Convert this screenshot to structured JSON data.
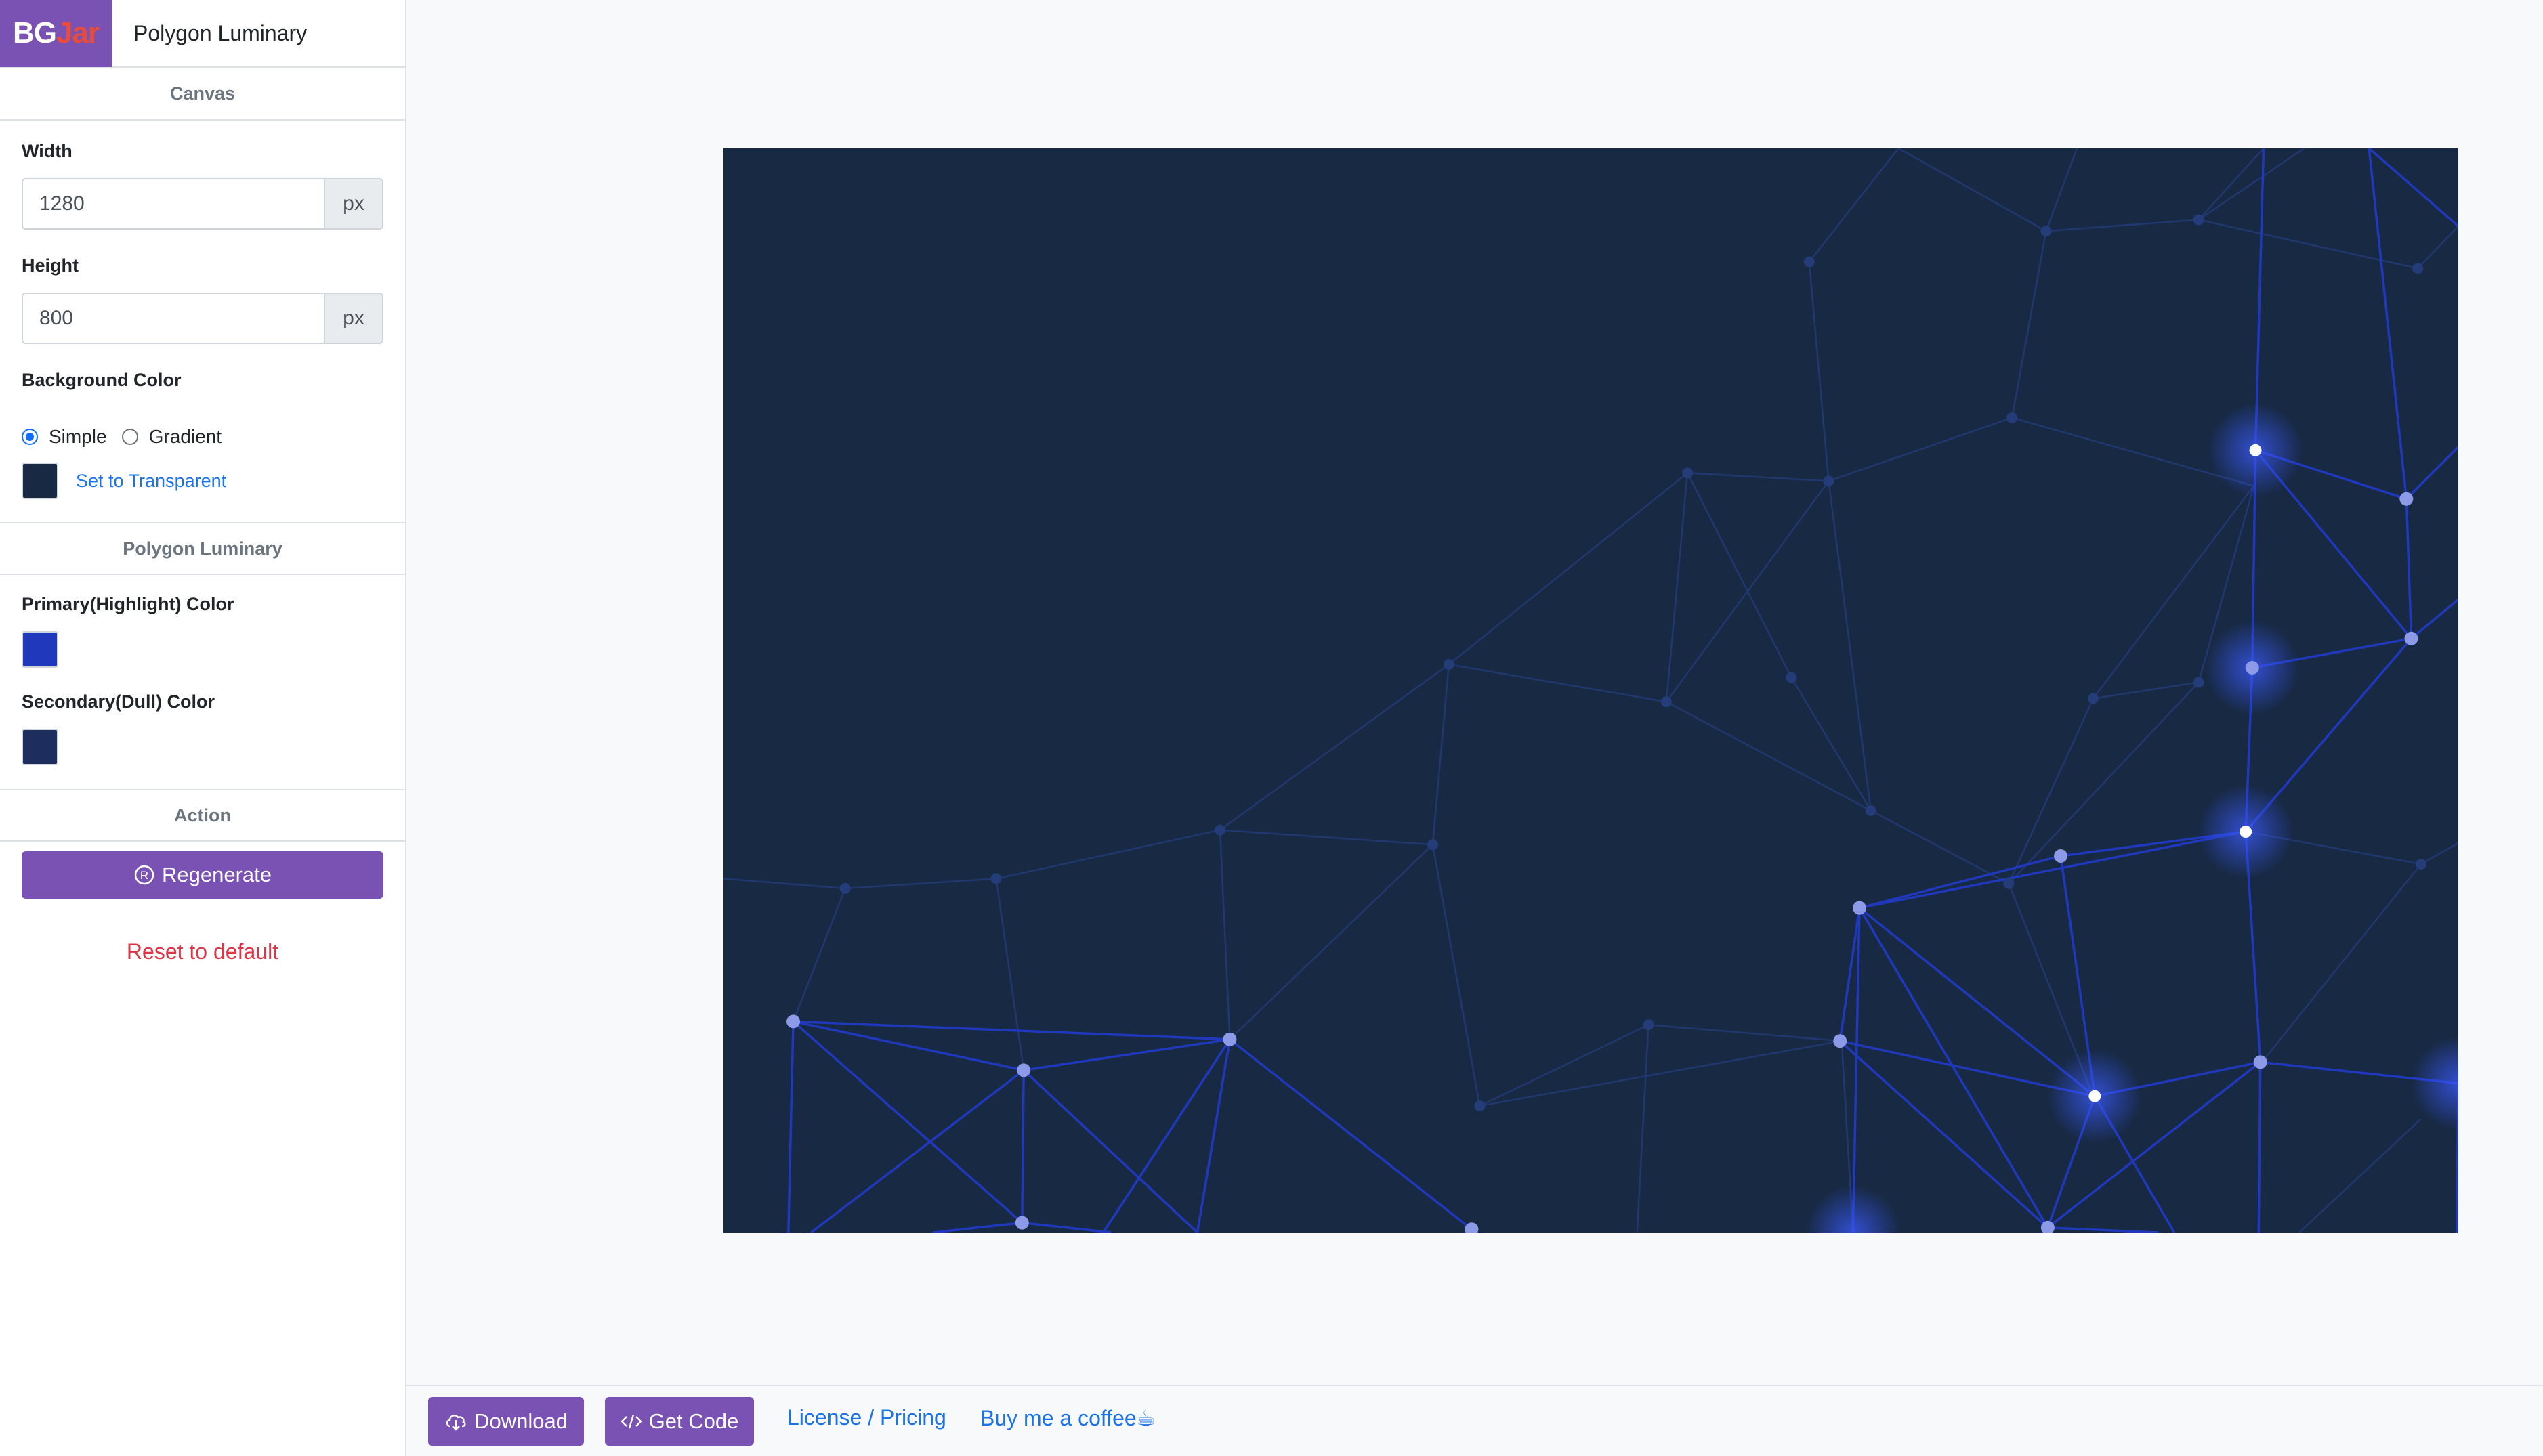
{
  "brand": {
    "logo_part1": "BG",
    "logo_part2": "Jar",
    "title": "Polygon Luminary"
  },
  "sidebar": {
    "canvas_header": "Canvas",
    "width_label": "Width",
    "width_value": "1280",
    "width_unit": "px",
    "height_label": "Height",
    "height_value": "800",
    "height_unit": "px",
    "background_label": "Background Color",
    "radio_simple": "Simple",
    "radio_gradient": "Gradient",
    "background_mode": "Simple",
    "background_color": "#172943",
    "transparent_link": "Set to Transparent",
    "pattern_header": "Polygon Luminary",
    "primary_label": "Primary(Highlight) Color",
    "primary_color": "#2038bb",
    "secondary_label": "Secondary(Dull) Color",
    "secondary_color": "#1c2d5e",
    "action_header": "Action",
    "regenerate_label": "Regenerate",
    "reset_label": "Reset to default"
  },
  "footer": {
    "download_label": "Download",
    "getcode_label": "Get Code",
    "license_label": "License / Pricing",
    "coffee_label": "Buy me a coffee☕"
  },
  "colors": {
    "accent": "#7952b3",
    "link": "#1a73e8",
    "reset": "#dc3545"
  }
}
